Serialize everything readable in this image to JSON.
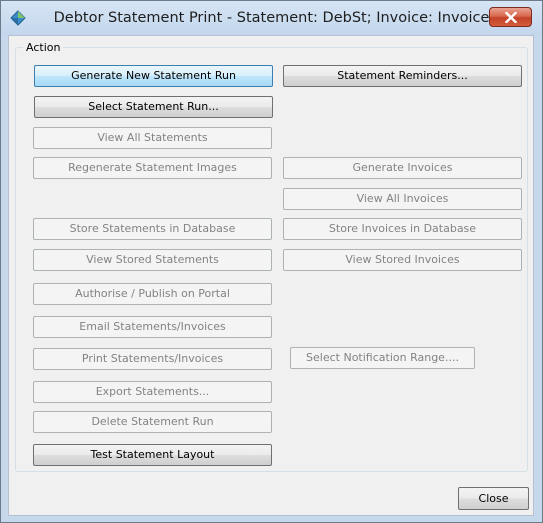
{
  "window": {
    "title": "Debtor Statement Print  - Statement: DebSt;  Invoice: Invoice"
  },
  "group": {
    "label": "Action"
  },
  "buttons": {
    "generate_new_statement_run": "Generate New Statement Run",
    "statement_reminders": "Statement Reminders...",
    "select_statement_run": "Select Statement Run...",
    "view_all_statements": "View All Statements",
    "regenerate_statement_images": "Regenerate Statement Images",
    "generate_invoices": "Generate Invoices",
    "view_all_invoices": "View All Invoices",
    "store_statements_in_database": "Store Statements in Database",
    "store_invoices_in_database": "Store Invoices in Database",
    "view_stored_statements": "View Stored Statements",
    "view_stored_invoices": "View Stored Invoices",
    "authorise_publish_on_portal": "Authorise / Publish on Portal",
    "email_statements_invoices": "Email Statements/Invoices",
    "print_statements_invoices": "Print Statements/Invoices",
    "select_notification_range": "Select Notification Range....",
    "export_statements": "Export Statements...",
    "delete_statement_run": "Delete Statement Run",
    "test_statement_layout": "Test Statement Layout",
    "close": "Close"
  },
  "colors": {
    "frame": "#c6d8ec",
    "client_background": "#f0f0f0",
    "disabled_text": "#838383",
    "focus_border": "#3c7fb1",
    "close_button_red": "#c3422a"
  },
  "icons": {
    "app": "app-diamond-icon",
    "close": "close-icon"
  }
}
